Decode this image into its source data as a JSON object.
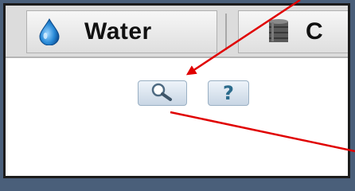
{
  "tabs": [
    {
      "label": "Water",
      "icon": "water-drop-icon"
    },
    {
      "label": "C",
      "icon": "database-icon"
    }
  ],
  "toolbar": {
    "search_icon": "magnifier-icon",
    "help_label": "?"
  },
  "colors": {
    "annotation_arrow": "#e00000",
    "outer_background": "#4a5f7a",
    "button_accent": "#2b6b8c"
  }
}
